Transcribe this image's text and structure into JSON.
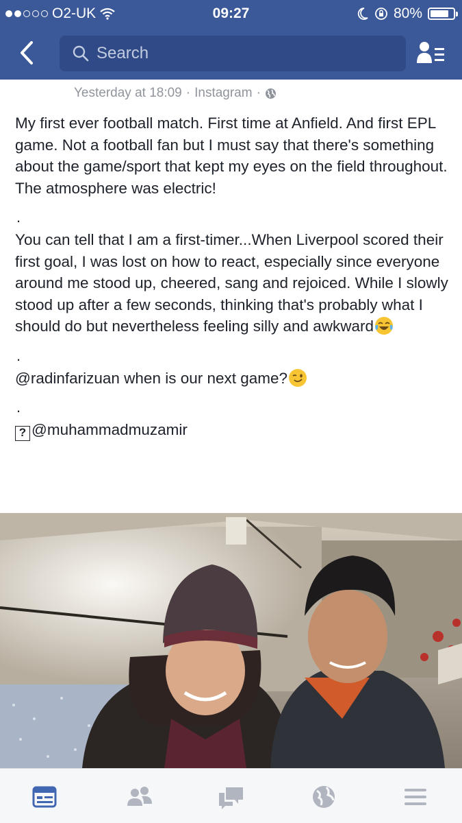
{
  "status_bar": {
    "carrier": "O2-UK",
    "time": "09:27",
    "battery": "80%",
    "battery_level": 0.8
  },
  "nav": {
    "search_placeholder": "Search",
    "back_icon": "chevron-left-icon",
    "friend_requests_icon": "friend-requests-icon"
  },
  "post": {
    "timestamp": "Yesterday at 18:09",
    "separator": "·",
    "source": "Instagram",
    "privacy_icon": "globe-icon",
    "paragraph1": "My first ever football match. First time at Anfield. And first EPL game. Not a football fan but I must say that there's something about the game/sport that kept my eyes on the field throughout. The atmosphere was electric!",
    "bullet": ".",
    "paragraph2": "You can tell that I am a first-timer...When Liverpool scored their first goal, I was lost on how to react, especially since everyone around me stood up, cheered, sang and rejoiced. While I slowly stood up after a few seconds, thinking that's probably what I should do but nevertheless feeling silly and awkward",
    "paragraph3": "@radinfarizuan when is our next game?",
    "unknown_glyph": "?",
    "mention": "@muhammadmuzamir",
    "emoji1": "tears-of-joy-emoji",
    "emoji2": "winking-face-emoji"
  },
  "tabs": [
    "news-feed-icon",
    "friends-icon",
    "messages-icon",
    "notifications-globe-icon",
    "menu-icon"
  ],
  "colors": {
    "brand_blue": "#3b5998",
    "search_bg": "#2f4a86",
    "active_tab": "#4267b2",
    "inactive_tab": "#b0b5bf",
    "meta_text": "#90949c"
  }
}
